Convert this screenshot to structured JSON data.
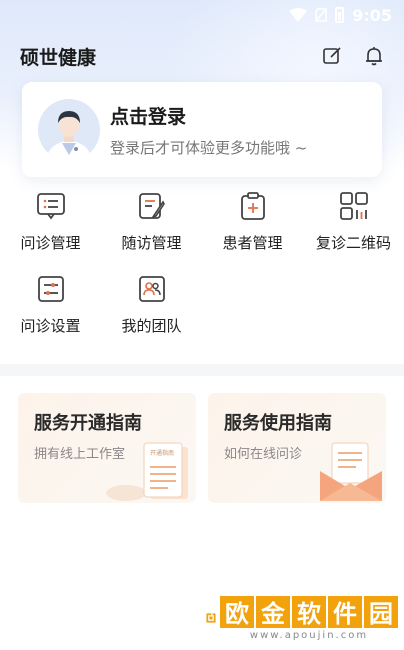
{
  "status": {
    "time": "9:05"
  },
  "header": {
    "title": "硕世健康"
  },
  "login": {
    "title": "点击登录",
    "subtitle": "登录后才可体验更多功能哦 ~"
  },
  "grid": {
    "items": [
      {
        "label": "问诊管理",
        "icon": "chat-list-icon"
      },
      {
        "label": "随访管理",
        "icon": "note-pen-icon"
      },
      {
        "label": "患者管理",
        "icon": "clipboard-plus-icon"
      },
      {
        "label": "复诊二维码",
        "icon": "qr-code-icon"
      },
      {
        "label": "问诊设置",
        "icon": "settings-sliders-icon"
      },
      {
        "label": "我的团队",
        "icon": "team-icon"
      }
    ]
  },
  "guides": [
    {
      "title": "服务开通指南",
      "subtitle": "拥有线上工作室",
      "illus_text": "开通指南"
    },
    {
      "title": "服务使用指南",
      "subtitle": "如何在线问诊"
    }
  ],
  "watermark": {
    "chars": [
      "欧",
      "金",
      "软",
      "件",
      "园"
    ],
    "url": "www.apoujin.com"
  },
  "colors": {
    "accent": "#e3704a",
    "watermark": "#f2a20c"
  }
}
